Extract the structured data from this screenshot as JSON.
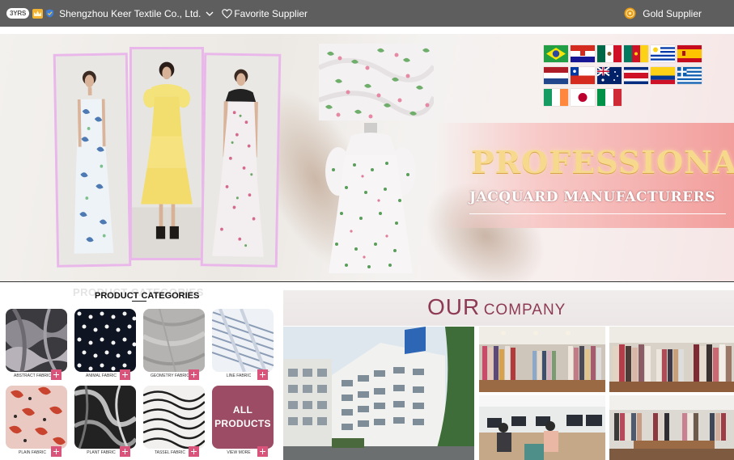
{
  "topbar": {
    "years_badge": "3YRS",
    "company_name": "Shengzhou Keer Textile Co., Ltd.",
    "favorite_label": "Favorite Supplier",
    "gold_label": "Gold Supplier"
  },
  "hero": {
    "title": "PROFESSIONAL",
    "subtitle": "JACQUARD MANUFACTURERS",
    "flags": [
      "Brazil",
      "Croatia",
      "Mexico",
      "Cameroon",
      "Uruguay",
      "Spain",
      "Netherlands",
      "Chile",
      "Australia",
      "Costa Rica",
      "Colombia",
      "Greece",
      "Ireland",
      "Japan",
      "Italy"
    ]
  },
  "categories": {
    "ghost_heading": "PRODUCT CATEGORIES",
    "heading": "PRODUCT CATEGORIES",
    "items": [
      {
        "label": "ABSTRACT FABRIC"
      },
      {
        "label": "ANIMAL FABRIC"
      },
      {
        "label": "GEOMETRY FABRIC"
      },
      {
        "label": "LINE FABRIC"
      },
      {
        "label": "PLAIN FABRIC"
      },
      {
        "label": "PLANT FABRIC"
      },
      {
        "label": "TASSEL FABRIC"
      },
      {
        "label": "VIEW MORE"
      }
    ],
    "all_products_line1": "ALL",
    "all_products_line2": "PRODUCTS"
  },
  "company": {
    "title_big": "OUR",
    "title_small": "COMPANY"
  },
  "colors": {
    "topbar": "#5e5e5e",
    "accent_pink": "#d9537a",
    "all_products_bg": "#9c4c64",
    "company_title": "#8d3b55",
    "hero_title_gold": "#f7d98d"
  }
}
